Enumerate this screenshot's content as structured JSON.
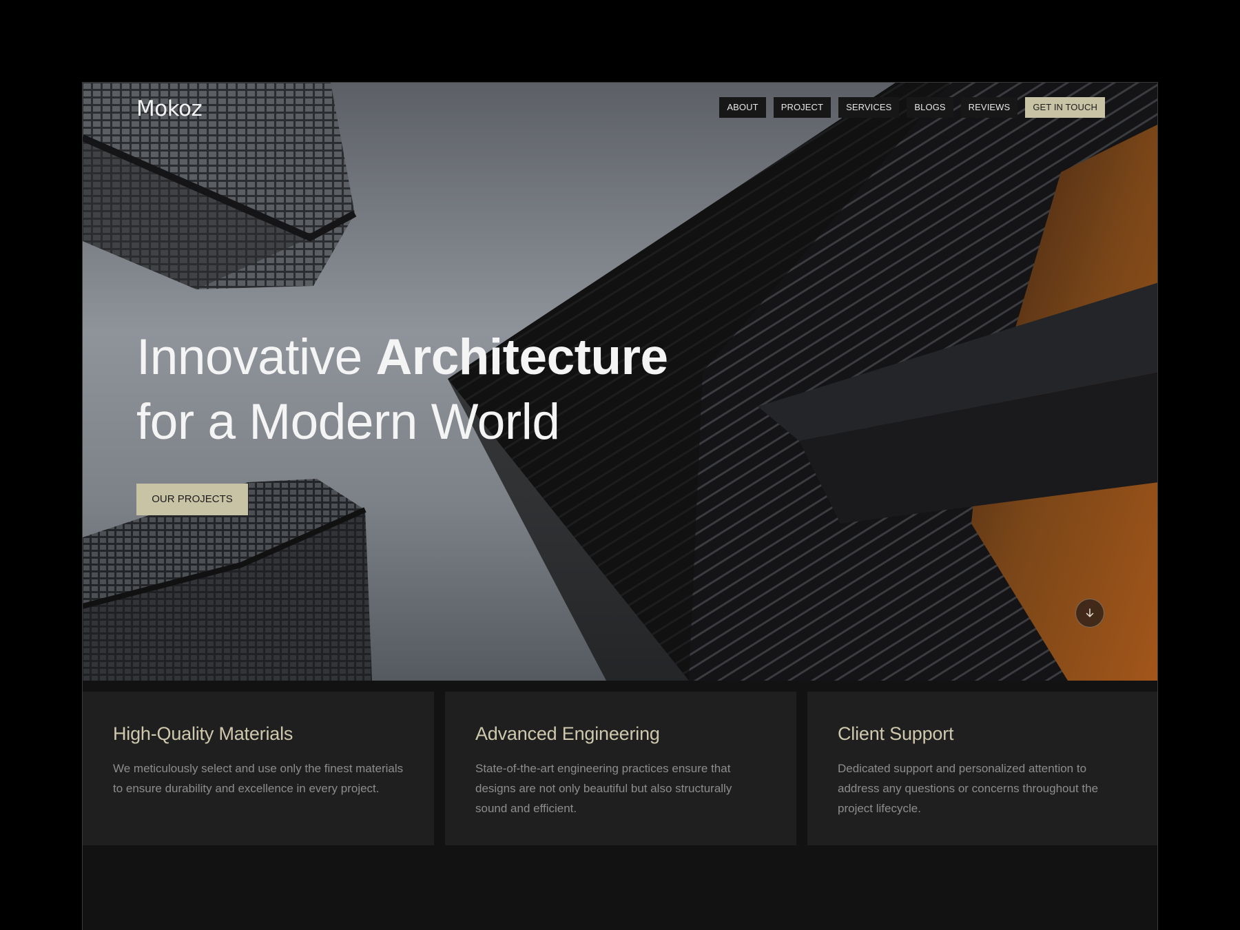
{
  "brand": {
    "logo": "Mokoz"
  },
  "nav": {
    "items": [
      "ABOUT",
      "PROJECT",
      "SERVICES",
      "BLOGS",
      "REVIEWS"
    ],
    "cta": "GET IN TOUCH"
  },
  "hero": {
    "headline_regular": "Innovative ",
    "headline_bold": "Architecture",
    "headline_line2": "for a Modern World",
    "button": "OUR PROJECTS",
    "scroll_icon": "arrow-down-icon"
  },
  "features": [
    {
      "title": "High-Quality Materials",
      "text": "We meticulously select and use only the finest materials to ensure durability and excellence in every project."
    },
    {
      "title": "Advanced Engineering",
      "text": "State-of-the-art engineering practices ensure that designs are not only beautiful but also structurally sound and efficient."
    },
    {
      "title": "Client Support",
      "text": "Dedicated support and personalized attention to address any questions or concerns throughout the project lifecycle."
    }
  ],
  "colors": {
    "accent": "#c9c3a6",
    "feature_title": "#cfc8ad",
    "card_bg": "#1f1f1f",
    "page_bg": "#121212"
  }
}
